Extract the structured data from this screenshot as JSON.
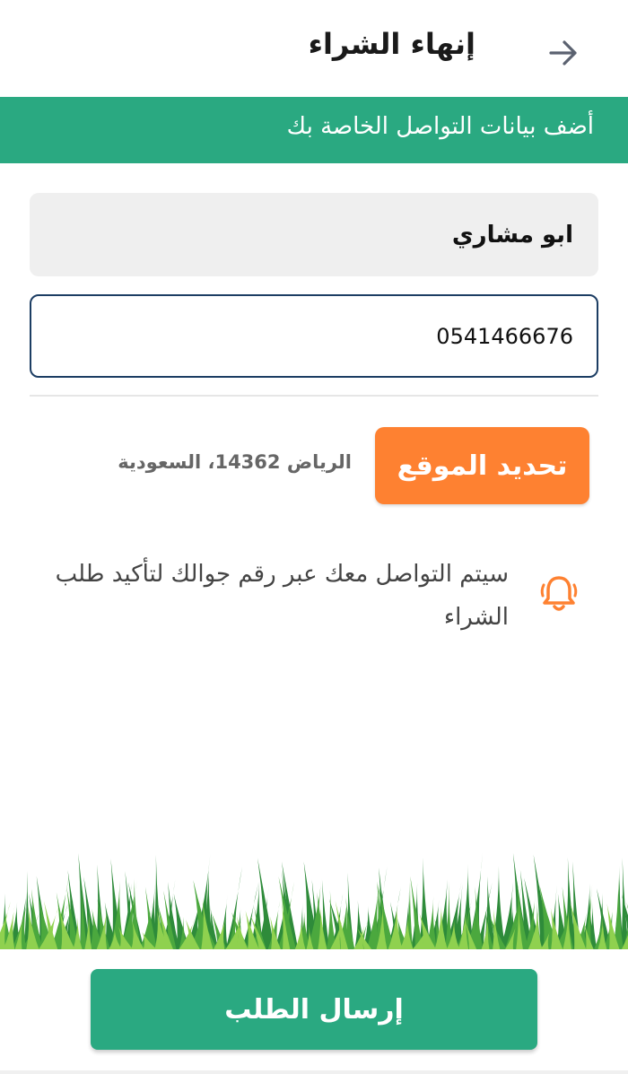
{
  "header": {
    "title": "إنهاء الشراء",
    "back_icon": "arrow-right-icon"
  },
  "banner": {
    "text": "أضف بيانات التواصل الخاصة بك"
  },
  "form": {
    "name_value": "ابو مشاري",
    "phone_value": "0541466676"
  },
  "location": {
    "button_label": "تحديد الموقع",
    "address": "الرياض 14362، السعودية"
  },
  "notice": {
    "icon": "bell-icon",
    "text": "سيتم التواصل معك عبر رقم جوالك لتأكيد طلب الشراء"
  },
  "footer": {
    "submit_label": "إرسال الطلب"
  },
  "colors": {
    "primary": "#2aa981",
    "accent": "#fe8131",
    "focus_border": "#1c3d63"
  }
}
